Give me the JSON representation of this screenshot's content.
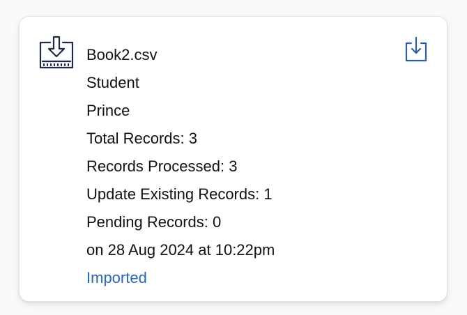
{
  "file": {
    "name": "Book2.csv",
    "entity": "Student",
    "user": "Prince",
    "total_records": "Total Records: 3",
    "records_processed": "Records Processed: 3",
    "update_existing": "Update Existing Records: 1",
    "pending_records": "Pending Records: 0",
    "imported_on": "on 28 Aug 2024 at 10:22pm",
    "status": "Imported"
  },
  "icons": {
    "file": "import-file-icon",
    "download": "download-icon"
  },
  "colors": {
    "status_link": "#2b66bf",
    "download_icon": "#2f5f9e",
    "file_icon": "#1f2a44"
  }
}
